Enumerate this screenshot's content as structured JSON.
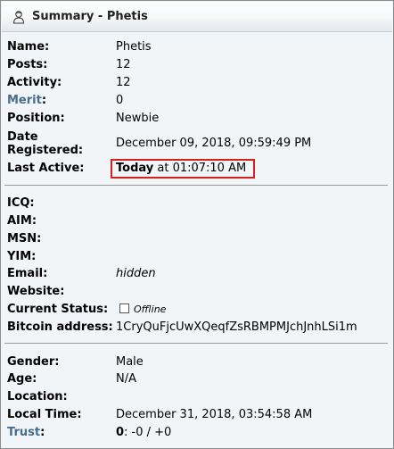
{
  "title": "Summary - Phetis",
  "icon": "user-icon",
  "section1": {
    "name_label": "Name:",
    "name_value": "Phetis",
    "posts_label": "Posts:",
    "posts_value": "12",
    "activity_label": "Activity:",
    "activity_value": "12",
    "merit_label": "Merit",
    "merit_colon": ":",
    "merit_value": "0",
    "position_label": "Position:",
    "position_value": "Newbie",
    "date_registered_label_1": "Date",
    "date_registered_label_2": "Registered:",
    "date_registered_value": "December 09, 2018, 09:59:49 PM",
    "last_active_label": "Last Active:",
    "last_active_today": "Today",
    "last_active_rest": " at 01:07:10 AM"
  },
  "section2": {
    "icq_label": "ICQ:",
    "aim_label": "AIM:",
    "msn_label": "MSN:",
    "yim_label": "YIM:",
    "email_label": "Email:",
    "email_value": "hidden",
    "website_label": "Website:",
    "status_label": "Current Status:",
    "status_value": "Offline",
    "bitcoin_label": "Bitcoin address:",
    "bitcoin_value": "1CryQuFjcUwXQeqfZsRBMPMJchJnhLSi1m"
  },
  "section3": {
    "gender_label": "Gender:",
    "gender_value": "Male",
    "age_label": "Age:",
    "age_value": "N/A",
    "location_label": "Location:",
    "localtime_label": "Local Time:",
    "localtime_value": "December 31, 2018, 03:54:58 AM",
    "trust_label": "Trust",
    "trust_colon": ":",
    "trust_score": "0",
    "trust_rest": ": -0 / +0"
  },
  "colors": {
    "link": "#476c8e",
    "highlight": "#d61f1f"
  }
}
